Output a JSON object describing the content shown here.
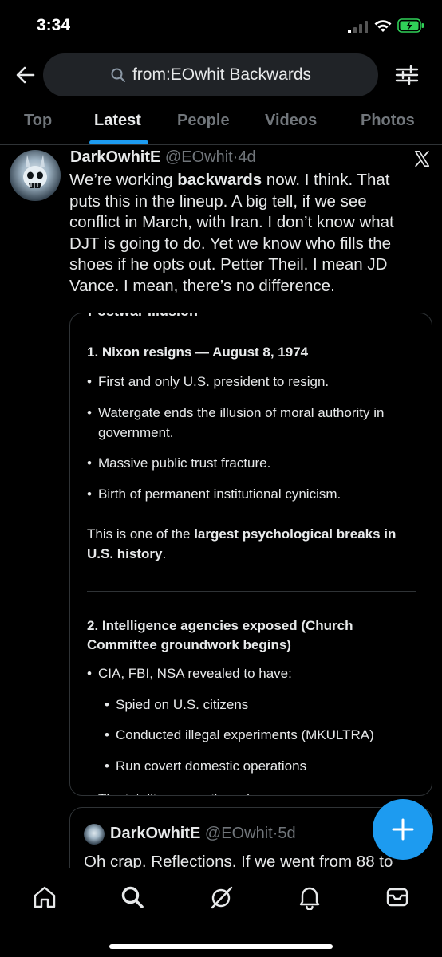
{
  "status_bar": {
    "time": "3:34"
  },
  "search": {
    "query": "from:EOwhit Backwards"
  },
  "tabs": [
    {
      "label": "Top",
      "active": false
    },
    {
      "label": "Latest",
      "active": true
    },
    {
      "label": "People",
      "active": false
    },
    {
      "label": "Videos",
      "active": false
    },
    {
      "label": "Photos",
      "active": false
    }
  ],
  "tweet": {
    "display_name": "DarkOwhitE",
    "handle": "@EOwhit",
    "separator": "·",
    "age": "4d",
    "text_parts": [
      "We’re working ",
      "backwards",
      " now. I think. That puts this in the lineup. A big tell, if we see conflict in March, with Iran. I don’t know what DJT is going to do. Yet we know who fills the shoes if he opts out. Petter Theil. I mean JD Vance. I mean, there’s no difference."
    ]
  },
  "card": {
    "cut_heading": "Postwar Illusion",
    "section1_title": "1. Nixon resigns — August 8, 1974",
    "section1_bullets": [
      "First and only U.S. president to resign.",
      "Watergate ends the illusion of moral authority in government.",
      "Massive public trust fracture.",
      "Birth of permanent institutional cynicism."
    ],
    "para_before": "This is one of the ",
    "para_bold": "largest psychological breaks in U.S. history",
    "para_after": ".",
    "section2_title": "2. Intelligence agencies exposed (Church Committee groundwork begins)",
    "section2_bullet": "CIA, FBI, NSA revealed to have:",
    "section2_sub_bullets": [
      "Spied on U.S. citizens",
      "Conducted illegal experiments (MKULTRA)",
      "Run covert domestic operations"
    ],
    "cut_bottom": "The intelligence veil cracks",
    "bullet_char": "•"
  },
  "quote": {
    "display_name": "DarkOwhitE",
    "handle": "@EOwhit",
    "separator": "·",
    "age": "5d",
    "text": "Oh crap. Reflections. If we went from 88 to"
  },
  "icons": {
    "back": "arrow-left-icon",
    "search": "search-icon",
    "filters": "filter-sliders-icon",
    "x_logo": "x-logo-icon",
    "compose": "plus-icon",
    "nav": [
      "home-icon",
      "search-icon",
      "grok-icon",
      "bell-icon",
      "mail-icon"
    ]
  },
  "colors": {
    "accent": "#1d9bf0",
    "background": "#000000",
    "text": "#e7e9ea",
    "muted": "#71767b",
    "border": "#2f3336",
    "battery": "#30d158"
  }
}
